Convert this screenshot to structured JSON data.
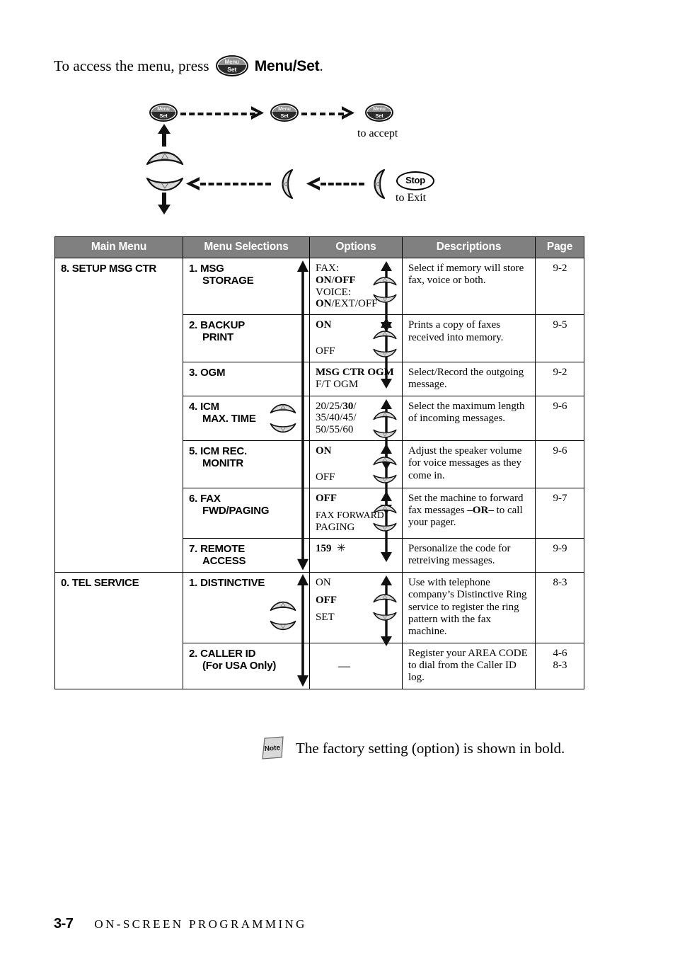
{
  "intro": {
    "text_before": "To access the menu, press",
    "button_label_top": "Menu",
    "button_label_bottom": "Set",
    "text_after": "Menu/Set",
    "period": "."
  },
  "flow_diagram": {
    "nodes": [
      {
        "name": "menu-set-1",
        "type": "menu-set-key",
        "top": "Menu",
        "bottom": "Set"
      },
      {
        "name": "menu-set-2",
        "type": "menu-set-key",
        "top": "Menu",
        "bottom": "Set"
      },
      {
        "name": "menu-set-3",
        "type": "menu-set-key",
        "top": "Menu",
        "bottom": "Set"
      },
      {
        "name": "up-arrow-key",
        "type": "rocker-up"
      },
      {
        "name": "down-arrow-key",
        "type": "rocker-down"
      },
      {
        "name": "left-arrow-key-1",
        "type": "rocker-left"
      },
      {
        "name": "left-arrow-key-2",
        "type": "rocker-left"
      },
      {
        "name": "stop-key",
        "type": "stop-button",
        "label": "Stop"
      }
    ],
    "captions": {
      "to_accept": "to accept",
      "to_exit": "to Exit"
    }
  },
  "table": {
    "headers": [
      "Main Menu",
      "Menu Selections",
      "Options",
      "Descriptions",
      "Page"
    ],
    "groups": [
      {
        "main_menu": "8. SETUP MSG CTR",
        "rows": [
          {
            "selection_line1": "1. MSG",
            "selection_line2": "STORAGE",
            "options_html": "FAX:<br><b>ON</b>/<b>OFF</b><br>VOICE:<br><b>ON</b>/EXT/OFF",
            "options_text": "FAX: ON/OFF VOICE: ON/EXT/OFF",
            "description": "Select if memory will store fax, voice or both.",
            "page": "9-2",
            "has_option_arrow": true
          },
          {
            "selection_line1": "2. BACKUP",
            "selection_line2": "PRINT",
            "options_html": "<b>ON</b><span class=\"opt-gap\"></span>OFF",
            "options_text": "ON OFF",
            "description": "Prints a copy of faxes received into memory.",
            "page": "9-5",
            "has_option_arrow": true
          },
          {
            "selection_line1": "3. OGM",
            "selection_line2": "",
            "options_html": "<b>MSG CTR OGM</b><br>F/T OGM",
            "options_text": "MSG CTR OGM F/T OGM",
            "description": "Select/Record the outgoing message.",
            "page": "9-2",
            "has_option_arrow": false
          },
          {
            "selection_line1": "4. ICM",
            "selection_line2": "MAX. TIME",
            "options_html": "20/25/<b>30</b>/<br>35/40/45/<br>50/55/60",
            "options_text": "20/25/30/35/40/45/50/55/60",
            "description": "Select the maximum length of incoming messages.",
            "page": "9-6",
            "has_option_arrow": true
          },
          {
            "selection_line1": "5. ICM REC.",
            "selection_line2": "MONITR",
            "options_html": "<b>ON</b><span class=\"opt-gap\"></span>OFF",
            "options_text": "ON OFF",
            "description": "Adjust the speaker volume for voice messages as they come in.",
            "page": "9-6",
            "has_option_arrow": true
          },
          {
            "selection_line1": "6. FAX",
            "selection_line2": "FWD/PAGING",
            "options_html": "<b>OFF</b><span class=\"opt-gap-s\"></span><span class=\"sc\">FAX FORWARD</span><br>PAGING",
            "options_text": "OFF FAX FORWARD PAGING",
            "description": "Set the machine to forward fax messages –OR– to call your pager.",
            "page": "9-7",
            "has_option_arrow": true
          },
          {
            "selection_line1": "7. REMOTE",
            "selection_line2": "ACCESS",
            "options_html": "<b>159</b>&nbsp;&nbsp;✳",
            "options_text": "159",
            "description": "Personalize the code for retreiving messages.",
            "page": "9-9",
            "has_option_arrow": false
          }
        ]
      },
      {
        "main_menu": "0. TEL SERVICE",
        "rows": [
          {
            "selection_line1": "1. DISTINCTIVE",
            "selection_line2": "",
            "options_html": "ON<span class=\"opt-gap-s\"></span><b>OFF</b><span class=\"opt-gap-s\"></span>SET",
            "options_text": "ON OFF SET",
            "description": "Use with telephone company’s Distinctive Ring service to register the ring pattern with the fax machine.",
            "page": "8-3",
            "has_option_arrow": true
          },
          {
            "selection_line1": "2. CALLER ID",
            "selection_line2": "(For USA Only)",
            "options_html": "<span class=\"dash-opt\">—</span>",
            "options_text": "—",
            "description": "Register your AREA CODE to dial from the Caller ID log.",
            "page": "4-6\n8-3",
            "has_option_arrow": false
          }
        ]
      }
    ]
  },
  "note": {
    "icon_label": "Note",
    "text": "The factory setting (option) is shown in bold."
  },
  "footer": {
    "page_number": "3-7",
    "chapter": "ON-SCREEN PROGRAMMING"
  },
  "colors": {
    "header_bg": "#808080",
    "header_text": "#ffffff",
    "key_fill": "#d9d9d9",
    "line": "#000000"
  }
}
